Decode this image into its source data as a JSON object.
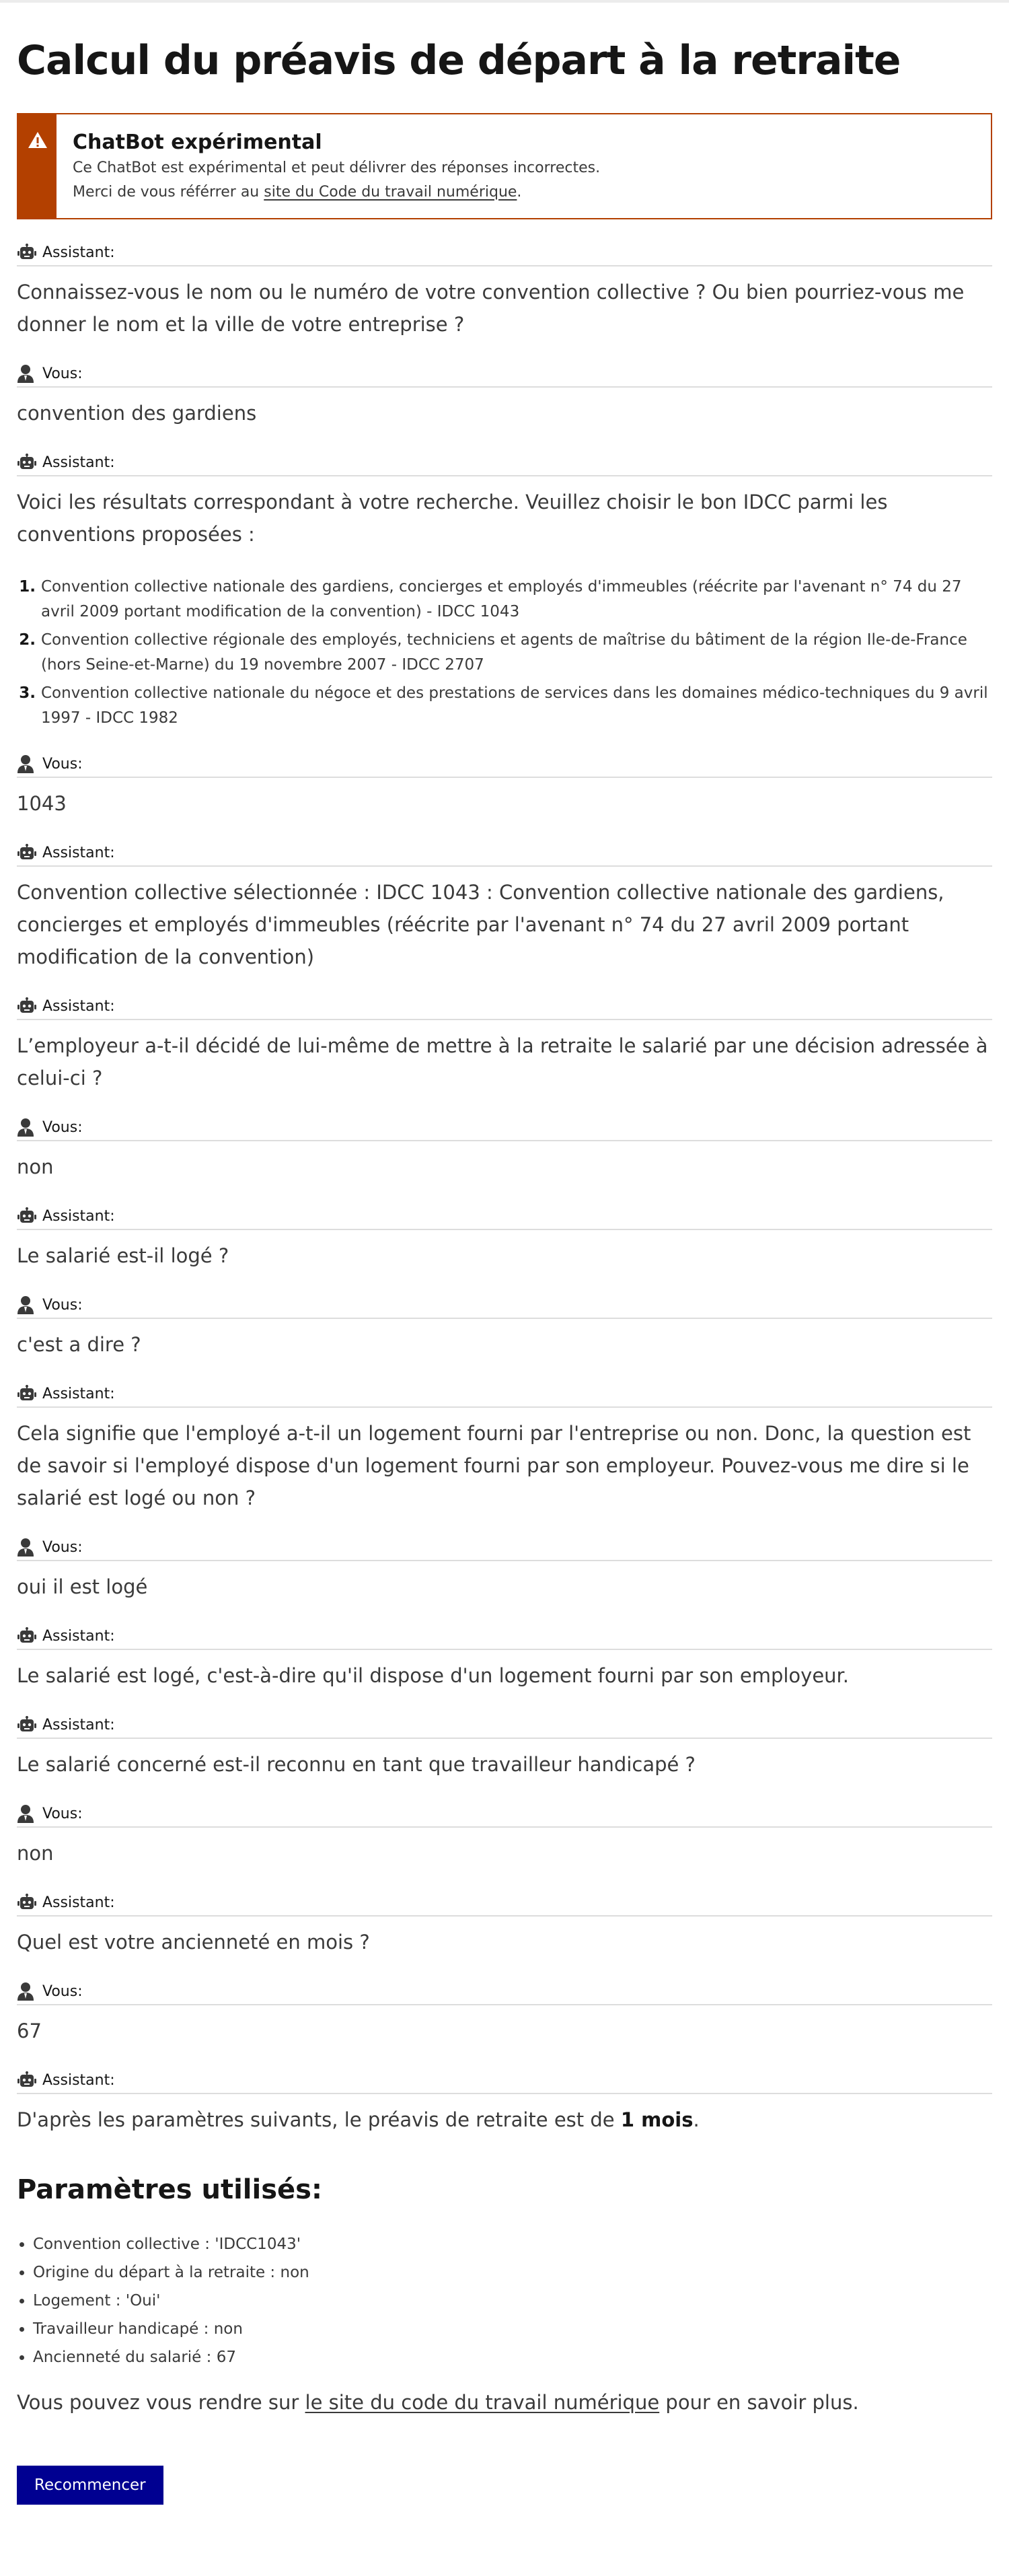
{
  "page": {
    "title": "Calcul du préavis de départ à la retraite"
  },
  "alert": {
    "title": "ChatBot expérimental",
    "line1": "Ce ChatBot est expérimental et peut délivrer des réponses incorrectes.",
    "line2_prefix": "Merci de vous référrer au ",
    "line2_link": "site du Code du travail numérique",
    "line2_suffix": ".",
    "icon": "warning-icon",
    "color": "#b34000"
  },
  "roles": {
    "assistant": "Assistant:",
    "user": "Vous:"
  },
  "messages": [
    {
      "role": "assistant",
      "text": "Connaissez-vous le nom ou le numéro de votre convention collective ? Ou bien pourriez-vous me donner le nom et la ville de votre entreprise ?"
    },
    {
      "role": "user",
      "text": "convention des gardiens"
    },
    {
      "role": "assistant",
      "text": "Voici les résultats correspondant à votre recherche. Veuillez choisir le bon IDCC parmi les conventions proposées :",
      "list": [
        "Convention collective nationale des gardiens, concierges et employés d'immeubles (réécrite par l'avenant n° 74 du 27 avril 2009 portant modification de la convention) - IDCC 1043",
        "Convention collective régionale des employés, techniciens et agents de maîtrise du bâtiment de la région Ile-de-France (hors Seine-et-Marne) du 19 novembre 2007 - IDCC 2707",
        "Convention collective nationale du négoce et des prestations de services dans les domaines médico-techniques du 9 avril 1997 - IDCC 1982"
      ]
    },
    {
      "role": "user",
      "text": "1043"
    },
    {
      "role": "assistant",
      "text": "Convention collective sélectionnée : IDCC 1043 : Convention collective nationale des gardiens, concierges et employés d'immeubles (réécrite par l'avenant n° 74 du 27 avril 2009 portant modification de la convention)"
    },
    {
      "role": "assistant",
      "text": "L’employeur a-t-il décidé de lui-même de mettre à la retraite le salarié par une décision adressée à celui-ci ?"
    },
    {
      "role": "user",
      "text": "non"
    },
    {
      "role": "assistant",
      "text": "Le salarié est-il logé ?"
    },
    {
      "role": "user",
      "text": "c'est a dire ?"
    },
    {
      "role": "assistant",
      "text": "Cela signifie que l'employé a-t-il un logement fourni par l'entreprise ou non. Donc, la question est de savoir si l'employé dispose d'un logement fourni par son employeur. Pouvez-vous me dire si le salarié est logé ou non ?"
    },
    {
      "role": "user",
      "text": "oui il est logé"
    },
    {
      "role": "assistant",
      "text": "Le salarié est logé, c'est-à-dire qu'il dispose d'un logement fourni par son employeur."
    },
    {
      "role": "assistant",
      "text": "Le salarié concerné est-il reconnu en tant que travailleur handicapé ?"
    },
    {
      "role": "user",
      "text": "non"
    },
    {
      "role": "assistant",
      "text": "Quel est votre ancienneté en mois ?"
    },
    {
      "role": "user",
      "text": "67"
    }
  ],
  "result": {
    "role_label": "Assistant:",
    "prefix": "D'après les paramètres suivants, le préavis de retraite est de ",
    "value": "1 mois",
    "suffix": "."
  },
  "params": {
    "title": "Paramètres utilisés:",
    "items": [
      "Convention collective : 'IDCC1043'",
      "Origine du départ à la retraite : non",
      "Logement : 'Oui'",
      "Travailleur handicapé : non",
      "Ancienneté du salarié : 67"
    ]
  },
  "footer": {
    "prefix": "Vous pouvez vous rendre sur ",
    "link": "le site du code du travail numérique",
    "suffix": " pour en savoir plus."
  },
  "restart_button": {
    "label": "Recommencer",
    "color": "#000091"
  }
}
